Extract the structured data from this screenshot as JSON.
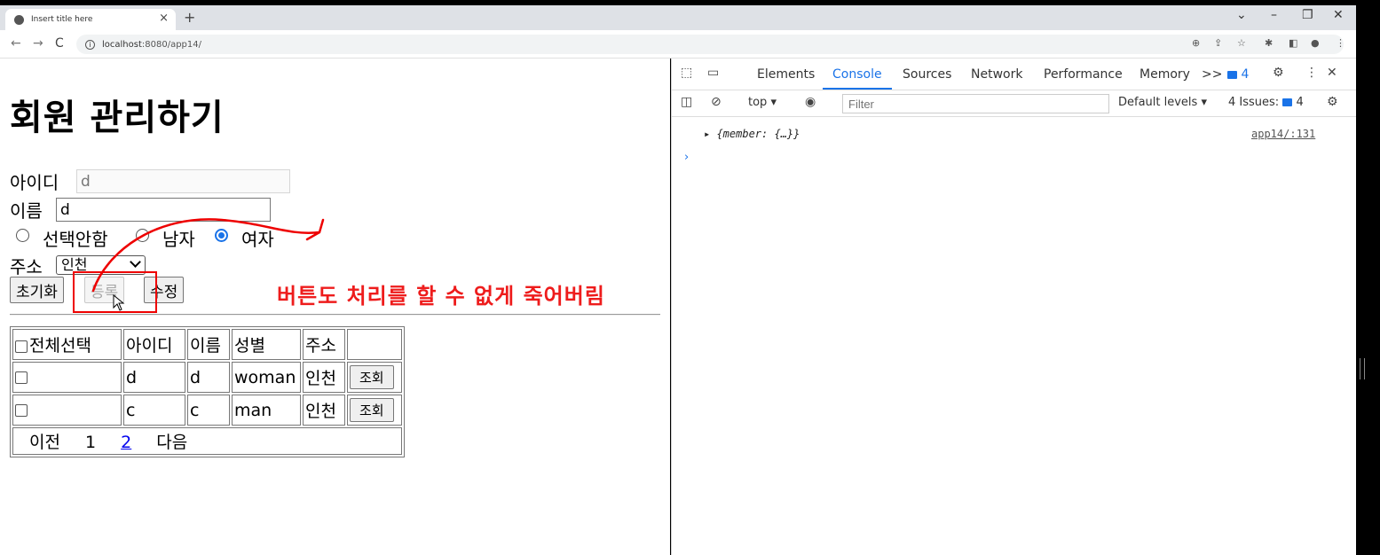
{
  "browser": {
    "tab_title": "Insert title here",
    "tab_close": "×",
    "new_tab": "+",
    "url_host": "localhost",
    "url_path": ":8080/app14/"
  },
  "page": {
    "heading": "회원 관리하기",
    "form": {
      "id_label": "아이디",
      "id_value": "d",
      "name_label": "이름",
      "name_value": "d",
      "gender_options": [
        "선택안함",
        "남자",
        "여자"
      ],
      "gender_selected": "여자",
      "address_label": "주소",
      "address_value": "인천"
    },
    "buttons": {
      "reset": "초기화",
      "register": "등록",
      "update": "수정"
    },
    "table": {
      "headers": [
        "전체선택",
        "아이디",
        "이름",
        "성별",
        "주소",
        ""
      ],
      "rows": [
        {
          "id": "d",
          "name": "d",
          "gender": "woman",
          "address": "인천",
          "action": "조회"
        },
        {
          "id": "c",
          "name": "c",
          "gender": "man",
          "address": "인천",
          "action": "조회"
        }
      ],
      "pager": {
        "prev": "이전",
        "page1": "1",
        "page2": "2",
        "next": "다음"
      }
    },
    "annotation": "버튼도 처리를 할 수 없게 죽어버림"
  },
  "devtools": {
    "tabs": [
      "Elements",
      "Console",
      "Sources",
      "Network",
      "Performance",
      "Memory"
    ],
    "active_tab": "Console",
    "more": ">>",
    "badge_count": "4",
    "context": "top",
    "filter_placeholder": "Filter",
    "default_levels": "Default levels",
    "issues_label": "4 Issues:",
    "issues_count": "4",
    "log_text": "{member: {…}}",
    "log_source": "app14/:131"
  }
}
